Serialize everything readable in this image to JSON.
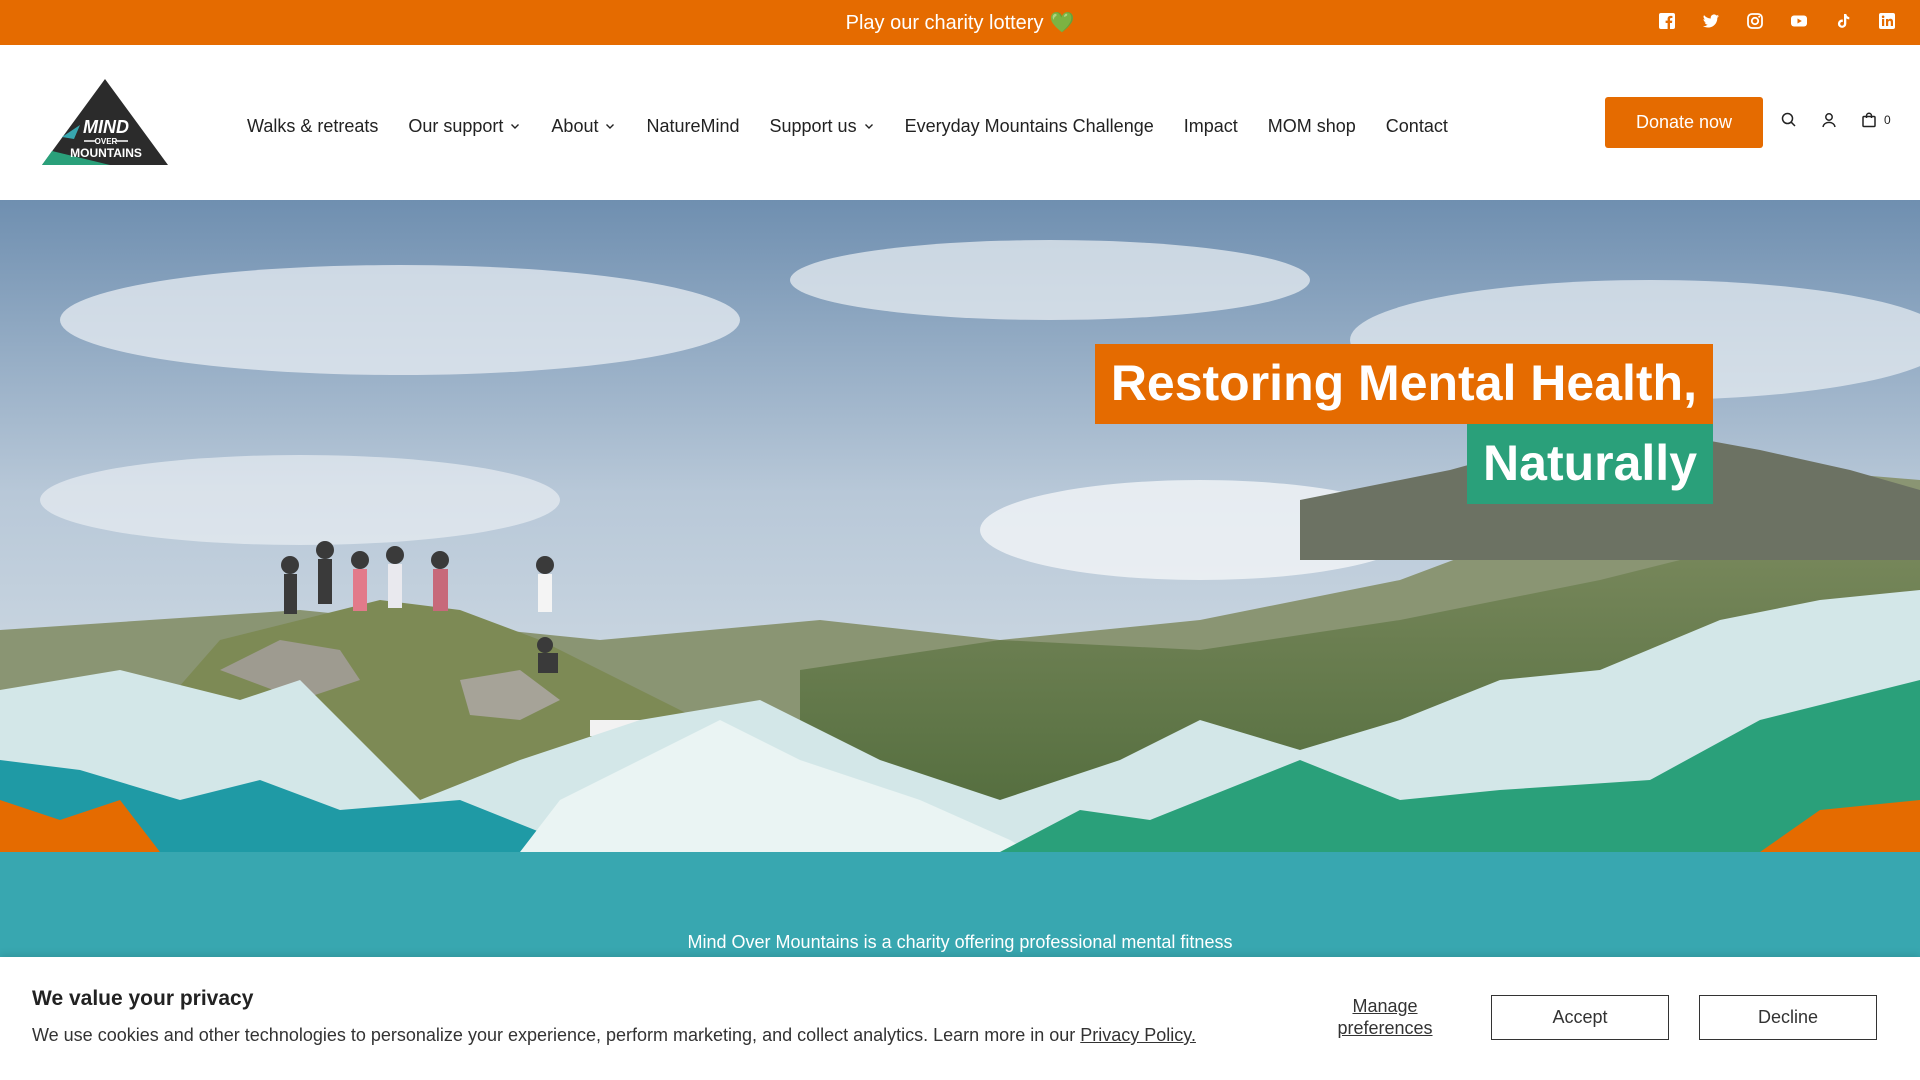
{
  "announcement": {
    "text": "Play our charity lottery",
    "emoji": "💚"
  },
  "socials": [
    "facebook-icon",
    "twitter-icon",
    "instagram-icon",
    "youtube-icon",
    "tiktok-icon",
    "linkedin-icon"
  ],
  "brand": {
    "logo_line1": "MIND",
    "logo_line2": "OVER",
    "logo_line3": "MOUNTAINS"
  },
  "nav": {
    "items": [
      {
        "label": "Walks & retreats",
        "dropdown": false
      },
      {
        "label": "Our support",
        "dropdown": true
      },
      {
        "label": "About",
        "dropdown": true
      },
      {
        "label": "NatureMind",
        "dropdown": false
      },
      {
        "label": "Support us",
        "dropdown": true
      },
      {
        "label": "Everyday Mountains Challenge",
        "dropdown": false
      },
      {
        "label": "Impact",
        "dropdown": false
      },
      {
        "label": "MOM shop",
        "dropdown": false
      },
      {
        "label": "Contact",
        "dropdown": false
      }
    ]
  },
  "header": {
    "donate_label": "Donate now",
    "cart_count": "0"
  },
  "hero": {
    "headline_line1": "Restoring Mental Health,",
    "headline_line2": "Naturally"
  },
  "intro": {
    "text": "Mind Over Mountains is a charity offering professional mental fitness"
  },
  "cookie": {
    "title": "We value your privacy",
    "text": "We use cookies and other technologies to personalize your experience, perform marketing, and collect analytics. Learn more in our",
    "link_label": "Privacy Policy.",
    "manage_label": "Manage preferences",
    "accept_label": "Accept",
    "decline_label": "Decline"
  },
  "colors": {
    "brand_orange": "#e56b00",
    "brand_green": "#2aa07a",
    "brand_teal": "#38a7b0"
  }
}
